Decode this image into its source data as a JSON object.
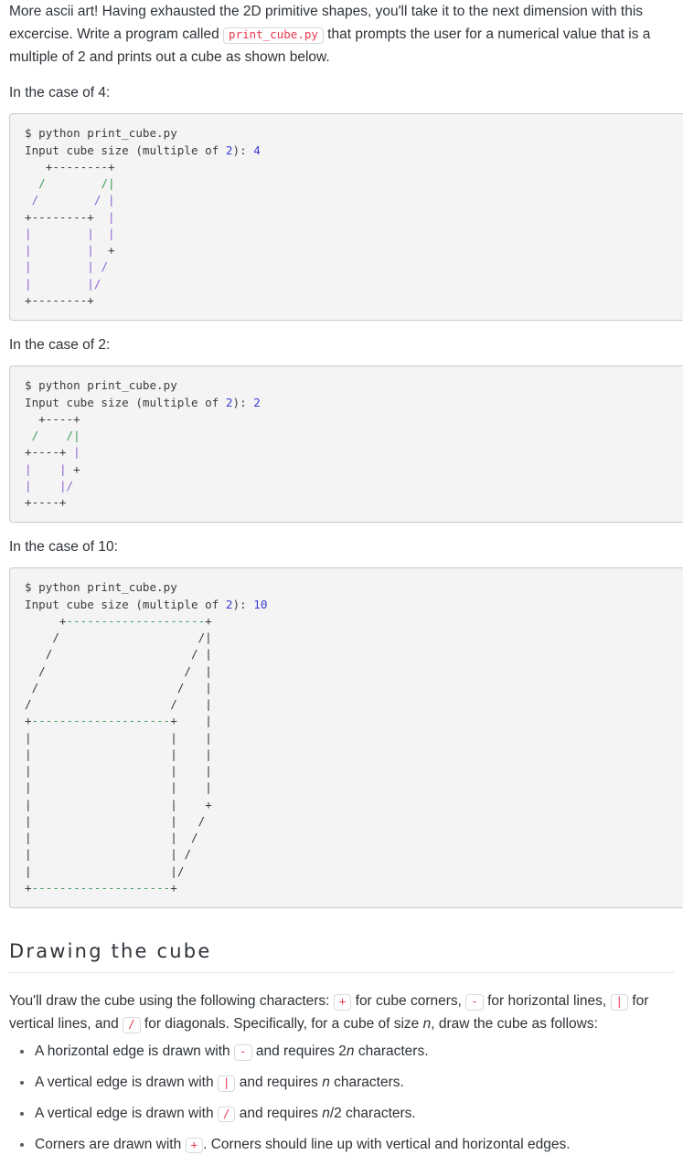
{
  "intro": {
    "text_before_code": "More ascii art! Having exhausted the 2D primitive shapes, you'll take it to the next dimension with this excercise. Write a program called ",
    "code": "print_cube.py",
    "text_after_code": " that prompts the user for a numerical value that is a multiple of 2 and prints out a cube as shown below."
  },
  "cases": [
    {
      "label": "In the case of 4:",
      "command": "$ python print_cube.py",
      "prompt_text": "Input cube size (multiple of 2): ",
      "prompt_two": "2",
      "prompt_prefix": "Input cube size (multiple of ",
      "prompt_mid": "): ",
      "size": "4",
      "art": "   +--------+\n  /        /|\n /        / |\n+--------+  |\n|        |  |\n|        |  +\n|        | /\n|        |/\n+--------+"
    },
    {
      "label": "In the case of 2:",
      "command": "$ python print_cube.py",
      "prompt_prefix": "Input cube size (multiple of ",
      "prompt_two": "2",
      "prompt_mid": "): ",
      "size": "2",
      "art": "  +----+\n /    /|\n+----+ |\n|    | +\n|    |/\n+----+"
    },
    {
      "label": "In the case of 10:",
      "command": "$ python print_cube.py",
      "prompt_prefix": "Input cube size (multiple of ",
      "prompt_two": "2",
      "prompt_mid": "): ",
      "size": "10",
      "art": "     +--------------------+\n    /                    /|\n   /                    / |\n  /                    /  |\n /                    /   |\n/                    /    |\n+--------------------+    |\n|                    |    |\n|                    |    |\n|                    |    |\n|                    |    |\n|                    |    +\n|                    |   /\n|                    |  /\n|                    | /\n|                    |/\n+--------------------+"
    }
  ],
  "section": {
    "title": "Drawing the cube",
    "intro_1": "You'll draw the cube using the following characters: ",
    "char_plus": "+",
    "intro_2": " for cube corners, ",
    "char_dash": "-",
    "intro_3": " for horizontal lines, ",
    "char_pipe": "|",
    "intro_4": " for vertical lines, and ",
    "char_slash": "/",
    "intro_5": " for diagonals. Specifically, for a cube of size ",
    "size_var": "n",
    "intro_6": ", draw the cube as follows:"
  },
  "bullets": [
    {
      "text_before": "A horizontal edge is drawn with ",
      "char": "-",
      "text_mid": " and requires 2",
      "var": "n",
      "text_after": " characters."
    },
    {
      "text_before": "A vertical edge is drawn with ",
      "char": "|",
      "text_mid": " and requires ",
      "var": "n",
      "text_after": " characters."
    },
    {
      "text_before": "A vertical edge is drawn with ",
      "char": "/",
      "text_mid": " and requires ",
      "var": "n",
      "text_after": "/2 characters."
    },
    {
      "text_before": "Corners are drawn with ",
      "char": "+",
      "text_mid": ". Corners should line up with vertical and horizontal edges.",
      "var": "",
      "text_after": ""
    }
  ],
  "colors": {
    "code_bg": "#f4f4f5",
    "code_border": "#c7ccd1",
    "inline_code_text": "#e8384f",
    "terminal_text": "#3b3b3b",
    "number_token": "#3b3bd0",
    "green_token": "#3f9d58",
    "purple_token": "#8a63d2",
    "body_text": "#2e3338"
  }
}
